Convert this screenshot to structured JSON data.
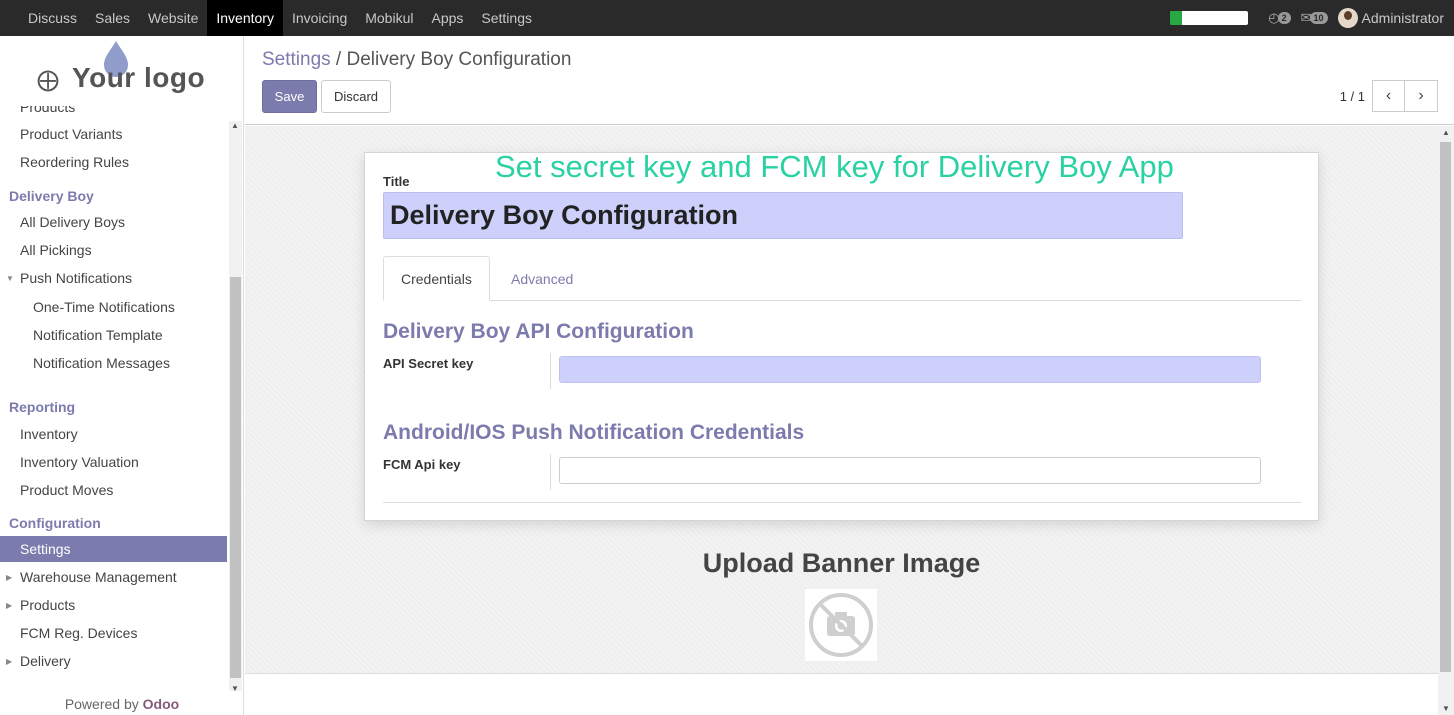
{
  "topbar": {
    "menu": [
      "Discuss",
      "Sales",
      "Website",
      "Inventory",
      "Invoicing",
      "Mobikul",
      "Apps",
      "Settings"
    ],
    "active_menu": "Inventory",
    "progress_percent": 15,
    "activity_count": "2",
    "messages_count": "10",
    "user_name": "Administrator"
  },
  "sidebar": {
    "logo_text": "Your logo",
    "items": [
      {
        "label": "Products",
        "type": "lvl1"
      },
      {
        "label": "Product Variants",
        "type": "lvl1"
      },
      {
        "label": "Reordering Rules",
        "type": "lvl1"
      },
      {
        "label": "Delivery Boy",
        "type": "section"
      },
      {
        "label": "All Delivery Boys",
        "type": "lvl1"
      },
      {
        "label": "All Pickings",
        "type": "lvl1"
      },
      {
        "label": "Push Notifications",
        "type": "lvl1"
      },
      {
        "label": "One-Time Notifications",
        "type": "lvl2"
      },
      {
        "label": "Notification Template",
        "type": "lvl2"
      },
      {
        "label": "Notification Messages",
        "type": "lvl2"
      },
      {
        "label": "Reporting",
        "type": "section"
      },
      {
        "label": "Inventory",
        "type": "lvl1"
      },
      {
        "label": "Inventory Valuation",
        "type": "lvl1"
      },
      {
        "label": "Product Moves",
        "type": "lvl1"
      },
      {
        "label": "Configuration",
        "type": "section"
      },
      {
        "label": "Settings",
        "type": "lvl1"
      },
      {
        "label": "Warehouse Management",
        "type": "lvl1"
      },
      {
        "label": "Products",
        "type": "lvl1"
      },
      {
        "label": "FCM Reg. Devices",
        "type": "lvl1"
      },
      {
        "label": "Delivery",
        "type": "lvl1"
      }
    ],
    "powered_prefix": "Powered by ",
    "powered_brand": "Odoo"
  },
  "control": {
    "breadcrumb_parent": "Settings",
    "breadcrumb_sep": " / ",
    "breadcrumb_current": "Delivery Boy Configuration",
    "save_label": "Save",
    "discard_label": "Discard",
    "pager_value": "1 / 1"
  },
  "form": {
    "annotation": "Set secret key and FCM  key for Delivery Boy App",
    "title_label": "Title",
    "title_value": "Delivery Boy Configuration",
    "tabs": [
      "Credentials",
      "Advanced"
    ],
    "group1_title": "Delivery Boy API Configuration",
    "api_secret_label": "API Secret key",
    "api_secret_value": "",
    "group2_title": "Android/IOS Push Notification Credentials",
    "fcm_label": "FCM Api key",
    "fcm_value": ""
  },
  "upload": {
    "title": "Upload Banner Image"
  }
}
